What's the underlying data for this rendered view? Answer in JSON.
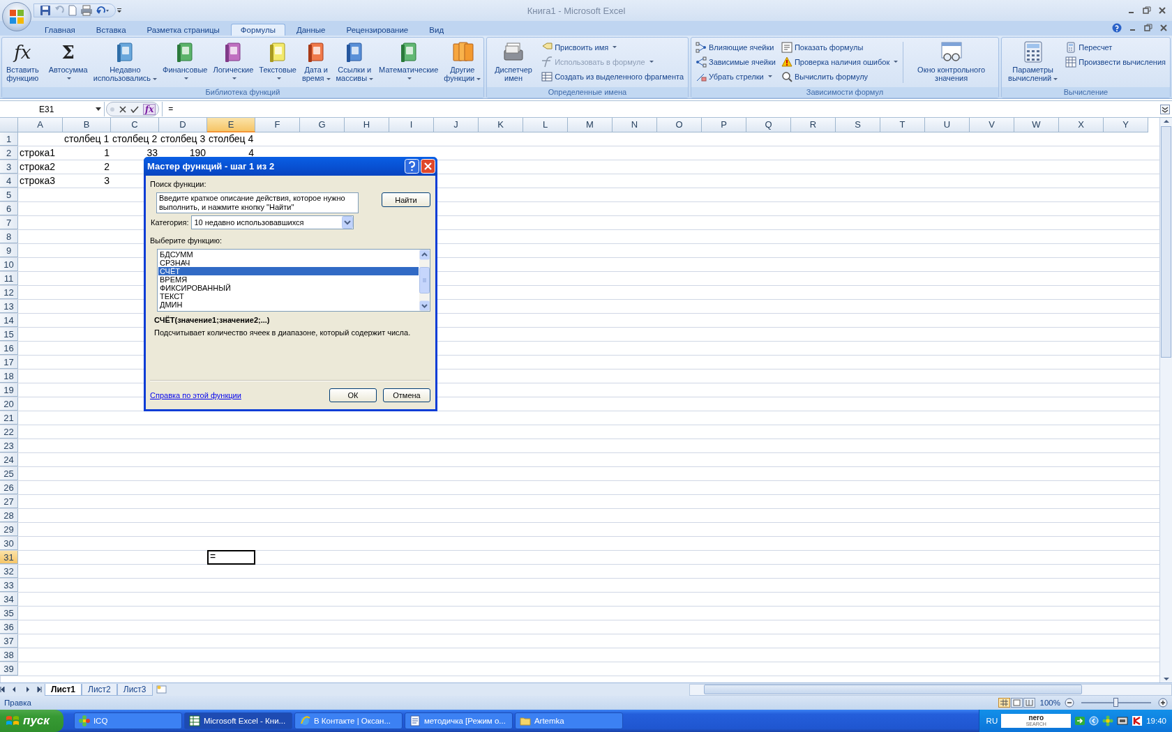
{
  "window": {
    "title": "Книга1 - Microsoft Excel"
  },
  "ribbon_tabs": [
    {
      "label": "Главная",
      "selected": false
    },
    {
      "label": "Вставка",
      "selected": false
    },
    {
      "label": "Разметка страницы",
      "selected": false
    },
    {
      "label": "Формулы",
      "selected": true
    },
    {
      "label": "Данные",
      "selected": false
    },
    {
      "label": "Рецензирование",
      "selected": false
    },
    {
      "label": "Вид",
      "selected": false
    }
  ],
  "ribbon_groups": [
    {
      "label": "Библиотека функций",
      "items": [
        {
          "kind": "large",
          "glyph": "fx",
          "lines": [
            "Вставить",
            "функцию"
          ],
          "dropdown": false
        },
        {
          "kind": "divider"
        },
        {
          "kind": "large",
          "glyph": "Σ",
          "lines": [
            "Автосумма"
          ],
          "dropdown": true
        },
        {
          "kind": "large",
          "lines": [
            "Недавно",
            "использовались"
          ],
          "dropdown": true
        },
        {
          "kind": "large",
          "lines": [
            "Финансовые"
          ],
          "dropdown": true
        },
        {
          "kind": "large",
          "lines": [
            "Логические"
          ],
          "dropdown": true
        },
        {
          "kind": "large",
          "lines": [
            "Текстовые"
          ],
          "dropdown": true
        },
        {
          "kind": "large",
          "lines": [
            "Дата и",
            "время"
          ],
          "dropdown": true
        },
        {
          "kind": "large",
          "lines": [
            "Ссылки и",
            "массивы"
          ],
          "dropdown": true
        },
        {
          "kind": "large",
          "lines": [
            "Математические"
          ],
          "dropdown": true
        },
        {
          "kind": "large",
          "lines": [
            "Другие",
            "функции"
          ],
          "dropdown": true
        }
      ]
    },
    {
      "label": "Определенные имена",
      "items": [
        {
          "kind": "large",
          "lines": [
            "Диспетчер",
            "имен"
          ],
          "dropdown": false
        },
        {
          "kind": "column",
          "items": [
            {
              "label": "Присвоить имя",
              "dropdown": true,
              "disabled": false
            },
            {
              "label": "Использовать в формуле",
              "dropdown": true,
              "disabled": true
            },
            {
              "label": "Создать из выделенного фрагмента",
              "dropdown": false,
              "disabled": false
            }
          ]
        }
      ]
    },
    {
      "label": "Зависимости формул",
      "items": [
        {
          "kind": "column",
          "items": [
            {
              "label": "Влияющие ячейки",
              "dropdown": false,
              "disabled": false
            },
            {
              "label": "Зависимые ячейки",
              "dropdown": false,
              "disabled": false
            },
            {
              "label": "Убрать стрелки",
              "dropdown": true,
              "disabled": false
            }
          ]
        },
        {
          "kind": "column",
          "items": [
            {
              "label": "Показать формулы",
              "dropdown": false,
              "disabled": false
            },
            {
              "label": "Проверка наличия ошибок",
              "dropdown": true,
              "disabled": false
            },
            {
              "label": "Вычислить формулу",
              "dropdown": false,
              "disabled": false
            }
          ]
        },
        {
          "kind": "divider"
        },
        {
          "kind": "large",
          "lines": [
            "Окно контрольного",
            "значения"
          ],
          "dropdown": false
        }
      ]
    },
    {
      "label": "Вычисление",
      "items": [
        {
          "kind": "large",
          "lines": [
            "Параметры",
            "вычислений"
          ],
          "dropdown": true
        },
        {
          "kind": "column",
          "items": [
            {
              "label": "Пересчет",
              "dropdown": false,
              "disabled": false
            },
            {
              "label": "Произвести вычисления",
              "dropdown": false,
              "disabled": false
            }
          ]
        }
      ]
    }
  ],
  "formula_bar": {
    "name_box": "E31",
    "fx_glyph": "fx",
    "formula": "="
  },
  "sheet": {
    "columns": [
      {
        "label": "A",
        "selected": false
      },
      {
        "label": "B",
        "selected": false
      },
      {
        "label": "C",
        "selected": false
      },
      {
        "label": "D",
        "selected": false
      },
      {
        "label": "E",
        "selected": true
      },
      {
        "label": "F",
        "selected": false
      },
      {
        "label": "G",
        "selected": false
      },
      {
        "label": "H",
        "selected": false
      },
      {
        "label": "I",
        "selected": false
      },
      {
        "label": "J",
        "selected": false
      },
      {
        "label": "K",
        "selected": false
      },
      {
        "label": "L",
        "selected": false
      },
      {
        "label": "M",
        "selected": false
      },
      {
        "label": "N",
        "selected": false
      },
      {
        "label": "O",
        "selected": false
      },
      {
        "label": "P",
        "selected": false
      },
      {
        "label": "Q",
        "selected": false
      },
      {
        "label": "R",
        "selected": false
      },
      {
        "label": "S",
        "selected": false
      },
      {
        "label": "T",
        "selected": false
      },
      {
        "label": "U",
        "selected": false
      },
      {
        "label": "V",
        "selected": false
      },
      {
        "label": "W",
        "selected": false
      },
      {
        "label": "X",
        "selected": false
      },
      {
        "label": "Y",
        "selected": false
      }
    ],
    "rows": [
      {
        "header": "1",
        "selected": false,
        "cells": {
          "B": {
            "value": "столбец 1",
            "kind": "text",
            "selected": false
          },
          "C": {
            "value": "столбец 2",
            "kind": "text",
            "selected": false
          },
          "D": {
            "value": "столбец 3",
            "kind": "text",
            "selected": false
          },
          "E": {
            "value": "столбец 4",
            "kind": "text",
            "selected": false
          }
        }
      },
      {
        "header": "2",
        "selected": false,
        "cells": {
          "A": {
            "value": "строка1",
            "kind": "text",
            "selected": false
          },
          "B": {
            "value": "1",
            "kind": "number",
            "selected": false
          },
          "C": {
            "value": "33",
            "kind": "number",
            "selected": false
          },
          "D": {
            "value": "190",
            "kind": "number",
            "selected": false
          },
          "E": {
            "value": "4",
            "kind": "number",
            "selected": false
          }
        }
      },
      {
        "header": "3",
        "selected": false,
        "cells": {
          "A": {
            "value": "строка2",
            "kind": "text",
            "selected": false
          },
          "B": {
            "value": "2",
            "kind": "number",
            "selected": false
          }
        }
      },
      {
        "header": "4",
        "selected": false,
        "cells": {
          "A": {
            "value": "строка3",
            "kind": "text",
            "selected": false
          },
          "B": {
            "value": "3",
            "kind": "number",
            "selected": false
          }
        }
      },
      {
        "header": "5",
        "selected": false
      },
      {
        "header": "6",
        "selected": false
      },
      {
        "header": "7",
        "selected": false
      },
      {
        "header": "8",
        "selected": false
      },
      {
        "header": "9",
        "selected": false
      },
      {
        "header": "10",
        "selected": false
      },
      {
        "header": "11",
        "selected": false
      },
      {
        "header": "12",
        "selected": false
      },
      {
        "header": "13",
        "selected": false
      },
      {
        "header": "14",
        "selected": false
      },
      {
        "header": "15",
        "selected": false
      },
      {
        "header": "16",
        "selected": false
      },
      {
        "header": "17",
        "selected": false
      },
      {
        "header": "18",
        "selected": false
      },
      {
        "header": "19",
        "selected": false
      },
      {
        "header": "20",
        "selected": false
      },
      {
        "header": "21",
        "selected": false
      },
      {
        "header": "22",
        "selected": false
      },
      {
        "header": "23",
        "selected": false
      },
      {
        "header": "24",
        "selected": false
      },
      {
        "header": "25",
        "selected": false
      },
      {
        "header": "26",
        "selected": false
      },
      {
        "header": "27",
        "selected": false
      },
      {
        "header": "28",
        "selected": false
      },
      {
        "header": "29",
        "selected": false
      },
      {
        "header": "30",
        "selected": false
      },
      {
        "header": "31",
        "selected": true,
        "cells": {
          "E": {
            "value": "=",
            "kind": "text",
            "selected": true
          }
        }
      },
      {
        "header": "32",
        "selected": false
      },
      {
        "header": "33",
        "selected": false
      },
      {
        "header": "34",
        "selected": false
      },
      {
        "header": "35",
        "selected": false
      },
      {
        "header": "36",
        "selected": false
      },
      {
        "header": "37",
        "selected": false
      },
      {
        "header": "38",
        "selected": false
      },
      {
        "header": "39",
        "selected": false
      }
    ]
  },
  "dialog": {
    "title": "Мастер функций - шаг 1 из 2",
    "search_label": "Поиск функции:",
    "search_value": "Введите краткое описание действия, которое нужно выполнить, и нажмите кнопку \"Найти\"",
    "find_button": "Найти",
    "category_label": "Категория:",
    "category_value": "10 недавно использовавшихся",
    "list_label": "Выберите функцию:",
    "functions": [
      {
        "name": "БДСУММ",
        "selected": false
      },
      {
        "name": "СРЗНАЧ",
        "selected": false
      },
      {
        "name": "СЧЁТ",
        "selected": true
      },
      {
        "name": "ВРЕМЯ",
        "selected": false
      },
      {
        "name": "ФИКСИРОВАННЫЙ",
        "selected": false
      },
      {
        "name": "ТЕКСТ",
        "selected": false
      },
      {
        "name": "ДМИН",
        "selected": false
      }
    ],
    "signature": "СЧЁТ(значение1;значение2;...)",
    "description": "Подсчитывает количество ячеек в диапазоне, который содержит числа.",
    "help_link": "Справка по этой функции",
    "buttons": [
      "ОК",
      "Отмена"
    ]
  },
  "sheet_tabs": [
    {
      "label": "Лист1",
      "selected": true
    },
    {
      "label": "Лист2",
      "selected": false
    },
    {
      "label": "Лист3",
      "selected": false
    }
  ],
  "status_bar": {
    "mode": "Правка",
    "zoom": "100%",
    "level": 0.5
  },
  "taskbar": {
    "start": "пуск",
    "items": [
      {
        "label": "ICQ",
        "selected": false
      },
      {
        "label": "Microsoft Excel - Кни...",
        "selected": true
      },
      {
        "label": "В Контакте | Оксан...",
        "selected": false
      },
      {
        "label": "методичка [Режим о...",
        "selected": false
      },
      {
        "label": "Artemka",
        "selected": false
      }
    ],
    "language": "RU",
    "search_logo": "nero",
    "search_logo_sub": "SEARCH",
    "clock": "19:40"
  }
}
